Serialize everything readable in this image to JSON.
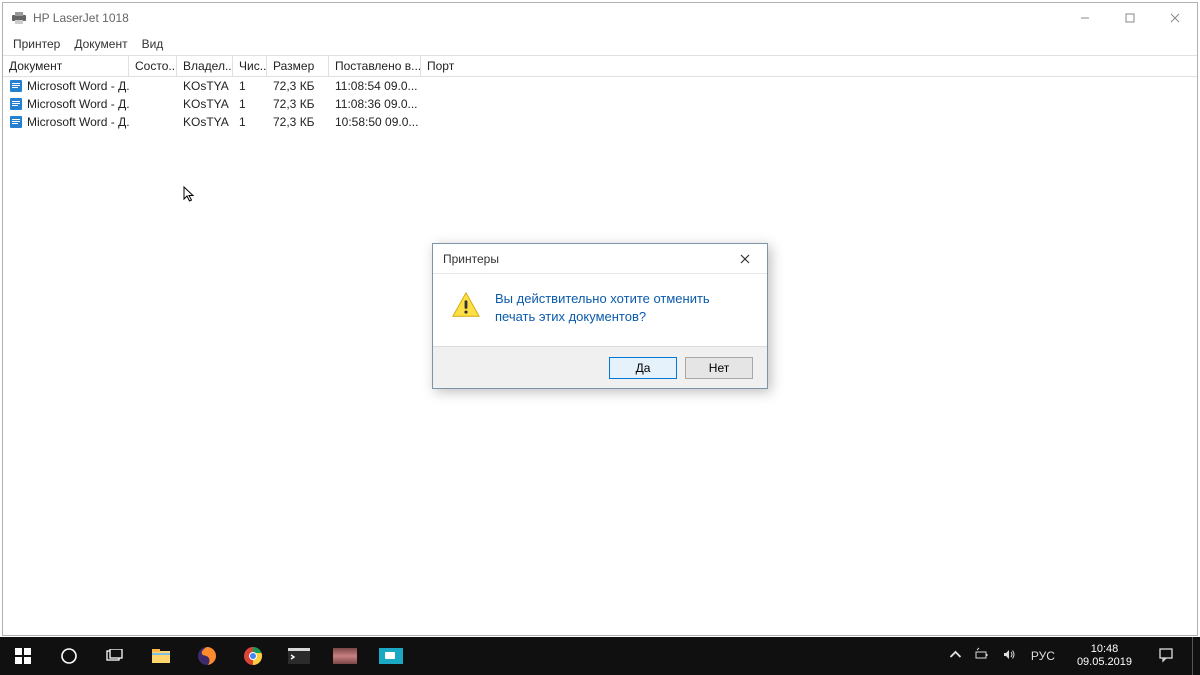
{
  "window": {
    "title": "HP LaserJet 1018",
    "menu": {
      "printer": "Принтер",
      "document": "Документ",
      "view": "Вид"
    },
    "columns": {
      "document": "Документ",
      "status": "Состо...",
      "owner": "Владел...",
      "pages": "Чис...",
      "size": "Размер",
      "submitted": "Поставлено в...",
      "port": "Порт"
    },
    "jobs": [
      {
        "name": "Microsoft Word - Д...",
        "status": "",
        "owner": "KOsTYA",
        "pages": "1",
        "size": "72,3 КБ",
        "submitted": "11:08:54  09.0..."
      },
      {
        "name": "Microsoft Word - Д...",
        "status": "",
        "owner": "KOsTYA",
        "pages": "1",
        "size": "72,3 КБ",
        "submitted": "11:08:36  09.0..."
      },
      {
        "name": "Microsoft Word - Д...",
        "status": "",
        "owner": "KOsTYA",
        "pages": "1",
        "size": "72,3 КБ",
        "submitted": "10:58:50  09.0..."
      }
    ]
  },
  "dialog": {
    "title": "Принтеры",
    "message": "Вы действительно хотите отменить печать этих документов?",
    "yes": "Да",
    "no": "Нет"
  },
  "taskbar": {
    "lang": "РУС",
    "time": "10:48",
    "date": "09.05.2019"
  }
}
